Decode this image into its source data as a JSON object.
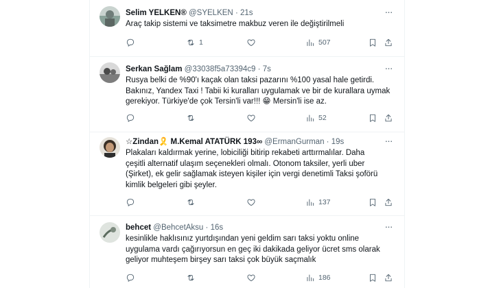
{
  "tweets": [
    {
      "name": "Selim YELKEN®",
      "handle": "@SYELKEN",
      "dot": "·",
      "time": "21s",
      "text": [
        "Araç takip sistemi ve taksimetre makbuz veren ile değiştirilmeli"
      ],
      "retweets": "1",
      "views": "507"
    },
    {
      "name": "Serkan Sağlam",
      "handle": "@33038f5a73394c9",
      "dot": "·",
      "time": "7s",
      "text": [
        "Rusya belki de %90'ı kaçak olan taksi  pazarını %100 yasal hale getirdi.",
        "Bakınız, Yandex Taxi ! Tabii ki kuralları uygulamak ve bir de kurallara uymak",
        "gerekiyor. Türkiye'de çok Tersin'li var!!! 😁 Mersin'li ise az."
      ],
      "retweets": "",
      "views": "52"
    },
    {
      "name": "☆Zindan🎗️ M.Kemal ATATÜRK 193∞",
      "handle": "@ErmanGurman",
      "dot": "·",
      "time": "19s",
      "text": [
        "Plakaları kaldırmak yerine, lobiciliği bitirip rekabeti arttırmalılar. Daha",
        "çeşitli alternatif ulaşım seçenekleri olmalı.  Otonom taksiler, yerli uber",
        "(Şirket), ek gelir sağlamak isteyen kişiler için vergi denetimli Taksi şoförü",
        "kimlik belgeleri gibi şeyler."
      ],
      "retweets": "",
      "views": "137"
    },
    {
      "name": "behcet",
      "handle": "@BehcetAksu",
      "dot": "·",
      "time": "16s",
      "text": [
        "kesinlikle haklısınız yurtdışından yeni geldim sarı taksi yoktu online",
        "uygulama vardı çağırıyorsun en geç iki dakikada geliyor ücret sms olarak",
        "geliyor muhteşem birşey sarı taksi çok büyük saçmalık"
      ],
      "retweets": "",
      "views": "186"
    }
  ],
  "icons": {
    "reply": "reply-icon",
    "retweet": "retweet-icon",
    "like": "like-icon",
    "views": "views-icon",
    "bookmark": "bookmark-icon",
    "share": "share-icon",
    "more": "more-icon"
  },
  "colors": {
    "secondary": "#536471",
    "border": "#eff3f4",
    "text": "#0f1419"
  }
}
